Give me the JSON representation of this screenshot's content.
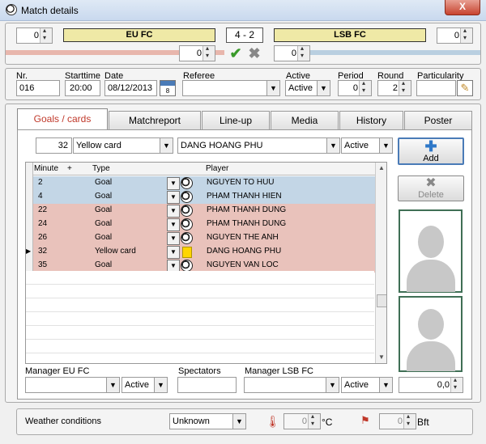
{
  "window": {
    "title": "Match details",
    "close_label": "X"
  },
  "scoreline": {
    "home_spin": "0",
    "home_team": "EU FC",
    "score": "4  - 2",
    "away_team": "LSB FC",
    "away_spin": "0",
    "home_extra_spin": "0",
    "away_extra_spin": "0"
  },
  "info": {
    "nr_label": "Nr.",
    "nr_value": "016",
    "starttime_label": "Starttime",
    "starttime_value": "20:00",
    "date_label": "Date",
    "date_value": "08/12/2013",
    "referee_label": "Referee",
    "referee_value": "",
    "active_label": "Active",
    "active_value": "Active",
    "period_label": "Period",
    "period_value": "0",
    "round_label": "Round",
    "round_value": "2",
    "particularity_label": "Particularity",
    "particularity_value": ""
  },
  "tabs": [
    "Goals / cards",
    "Matchreport",
    "Line-up",
    "Media",
    "History",
    "Poster"
  ],
  "event_form": {
    "minute": "32",
    "type": "Yellow card",
    "player": "DANG HOANG PHU",
    "status": "Active",
    "add_label": "Add",
    "delete_label": "Delete"
  },
  "grid": {
    "headers": {
      "minute": "Minute",
      "plus": "+",
      "type": "Type",
      "player": "Player"
    },
    "rows": [
      {
        "minute": "2",
        "type": "Goal",
        "player": "NGUYEN TO HUU",
        "team": "home",
        "icon": "ball"
      },
      {
        "minute": "4",
        "type": "Goal",
        "player": "PHAM THANH HIEN",
        "team": "home",
        "icon": "ball"
      },
      {
        "minute": "22",
        "type": "Goal",
        "player": "PHAM THANH DUNG",
        "team": "away",
        "icon": "ball"
      },
      {
        "minute": "24",
        "type": "Goal",
        "player": "PHAM THANH DUNG",
        "team": "away",
        "icon": "ball"
      },
      {
        "minute": "26",
        "type": "Goal",
        "player": "NGUYEN THE ANH",
        "team": "away",
        "icon": "ball"
      },
      {
        "minute": "32",
        "type": "Yellow card",
        "player": "DANG HOANG PHU",
        "team": "away",
        "icon": "yellow-card",
        "current": true
      },
      {
        "minute": "35",
        "type": "Goal",
        "player": "NGUYEN VAN LOC",
        "team": "away",
        "icon": "ball"
      }
    ]
  },
  "bottom": {
    "manager_home_label": "Manager EU FC",
    "manager_home_value": "",
    "manager_home_status": "Active",
    "spectators_label": "Spectators",
    "spectators_value": "",
    "manager_away_label": "Manager LSB FC",
    "manager_away_value": "",
    "manager_away_status": "Active",
    "rating_value": "0,0"
  },
  "weather": {
    "label": "Weather conditions",
    "condition": "Unknown",
    "temp_value": "0",
    "temp_unit": "°C",
    "wind_value": "0",
    "wind_unit": "Bft"
  },
  "colors": {
    "team_bar": "#efe9a6",
    "home_row": "#c3d6e6",
    "away_row": "#e9c2bb"
  }
}
